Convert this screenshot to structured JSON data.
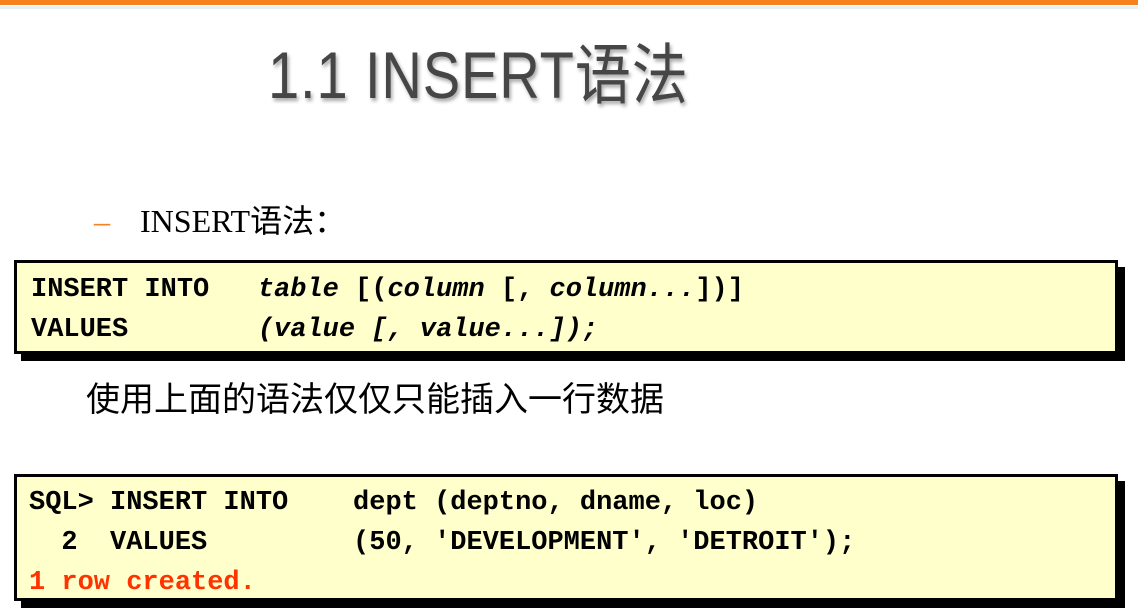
{
  "title": "1.1 INSERT语法",
  "bullet": {
    "marker": "–",
    "text": "INSERT语法："
  },
  "syntax": {
    "l1_kw": "INSERT INTO   ",
    "l1_a": "table",
    "l1_b": " [(",
    "l1_c": "column",
    "l1_d": " [, ",
    "l1_e": "column...",
    "l1_f": "])]",
    "l2_kw": "VALUES        ",
    "l2_a": "(value",
    "l2_b": " [, ",
    "l2_c": "value...",
    "l2_d": "]);"
  },
  "note": "使用上面的语法仅仅只能插入一行数据",
  "example": {
    "line1": "SQL> INSERT INTO    dept (deptno, dname, loc)",
    "line2": "  2  VALUES         (50, 'DEVELOPMENT', 'DETROIT');",
    "result": "1 row created."
  },
  "colors": {
    "accent": "#f5821f",
    "box_bg": "#ffffcc",
    "result": "#ff3300"
  }
}
